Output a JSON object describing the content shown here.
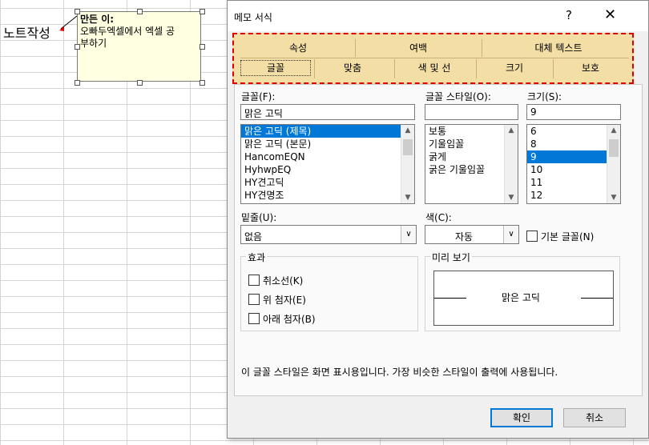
{
  "sheet": {
    "cell_text": "노트작성",
    "note": {
      "author": "만든 이:",
      "line1": "오빠두엑셀에서 엑셀 공",
      "line2": "부하기"
    }
  },
  "dialog": {
    "title": "메모 서식",
    "help": "?",
    "close": "✕",
    "tabs_row1": [
      "속성",
      "여백",
      "대체 텍스트"
    ],
    "tabs_row2": [
      "글꼴",
      "맞춤",
      "색 및 선",
      "크기",
      "보호"
    ],
    "font": {
      "label": "글꼴(F):",
      "value": "맑은 고딕",
      "items": [
        "맑은 고딕 (제목)",
        "맑은 고딕 (본문)",
        "HancomEQN",
        "HyhwpEQ",
        "HY견고딕",
        "HY견명조"
      ],
      "selected_index": 0
    },
    "style": {
      "label": "글꼴 스타일(O):",
      "value": "",
      "items": [
        "보통",
        "기울임꼴",
        "굵게",
        "굵은 기울임꼴"
      ]
    },
    "size": {
      "label": "크기(S):",
      "value": "9",
      "items": [
        "6",
        "8",
        "9",
        "10",
        "11",
        "12"
      ],
      "selected_index": 2
    },
    "underline": {
      "label": "밑줄(U):",
      "value": "없음"
    },
    "color": {
      "label": "색(C):",
      "value": "자동"
    },
    "normal_font_label": "기본 글꼴(N)",
    "effects": {
      "title": "효과",
      "strikethrough": "취소선(K)",
      "superscript": "위 첨자(E)",
      "subscript": "아래 첨자(B)"
    },
    "preview": {
      "title": "미리 보기",
      "text": "맑은 고딕"
    },
    "info": "이 글꼴 스타일은 화면 표시용입니다. 가장 비슷한 스타일이 출력에 사용됩니다.",
    "ok": "확인",
    "cancel": "취소"
  },
  "colors": {
    "highlight_tabs": "#f3dfa6",
    "dashed_border": "#e00000",
    "selection": "#0078d7"
  }
}
